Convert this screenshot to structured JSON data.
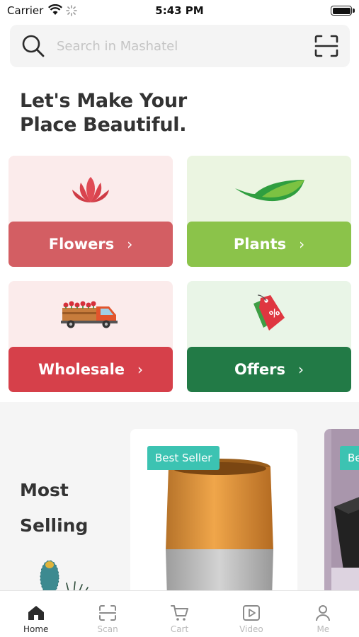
{
  "status_bar": {
    "carrier": "Carrier",
    "time": "5:43 PM"
  },
  "search": {
    "placeholder": "Search in Mashatel"
  },
  "headline": {
    "line1": "Let's Make Your",
    "line2": "Place Beautiful."
  },
  "categories": [
    {
      "label": "Flowers",
      "icon": "lotus-icon",
      "color": "#d35e63",
      "bg": "#fbebeb"
    },
    {
      "label": "Plants",
      "icon": "leaf-icon",
      "color": "#8bc34a",
      "bg": "#ebf5e1"
    },
    {
      "label": "Wholesale",
      "icon": "truck-icon",
      "color": "#d6404a",
      "bg": "#fbebeb"
    },
    {
      "label": "Offers",
      "icon": "price-tag-icon",
      "color": "#227a46",
      "bg": "#e9f5e7"
    }
  ],
  "most_selling": {
    "title_line1": "Most",
    "title_line2": "Selling",
    "products": [
      {
        "badge": "Best Seller"
      },
      {
        "badge": "Be"
      }
    ]
  },
  "tabs": [
    {
      "label": "Home",
      "icon": "home-icon",
      "active": true
    },
    {
      "label": "Scan",
      "icon": "scan-icon",
      "active": false
    },
    {
      "label": "Cart",
      "icon": "cart-icon",
      "active": false
    },
    {
      "label": "Video",
      "icon": "video-icon",
      "active": false
    },
    {
      "label": "Me",
      "icon": "person-icon",
      "active": false
    }
  ],
  "colors": {
    "badge": "#3cc3b2",
    "accent_text": "#333333"
  }
}
